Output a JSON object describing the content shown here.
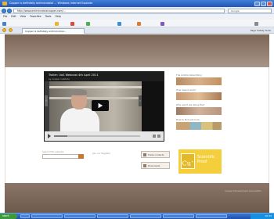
{
  "browser": {
    "window_title": "Copper is definitely antimicrobial ... Windows Internet Explorer",
    "url": "http://www.antimicrobialcopper.com/...",
    "search_placeholder": "Google",
    "menu": [
      "File",
      "Edit",
      "View",
      "Favorites",
      "Tools",
      "Help"
    ],
    "tab_label": "Copper is definitely antimicrobial...",
    "tab_tools": "Page  Safety  Tools"
  },
  "video": {
    "title": "Trailer: UoS Webcast 4th April 2011",
    "subtitle": "by Copper Institute",
    "progress": 0.15
  },
  "promos": [
    {
      "label": "The Antimicrobial Story"
    },
    {
      "label": "How does it work?"
    },
    {
      "label": "Why aren't we doing this?"
    },
    {
      "label": "How to find out more"
    }
  ],
  "bottom": {
    "search_label": "Search this website",
    "mid_label": "Join our Register",
    "button_1": "Trade contacts",
    "button_2": "Downloads"
  },
  "cu_card": {
    "symbol": "Cu",
    "superscript": "+",
    "line_1": "Scientific",
    "line_2": "Proof"
  },
  "footer": {
    "text": "Copper Development Association"
  },
  "taskbar": {
    "start": "start",
    "clock": "10:32"
  },
  "colors": {
    "brown": "#7b6555",
    "accent_yellow": "#f4cf3b",
    "orange": "#c7792e"
  }
}
